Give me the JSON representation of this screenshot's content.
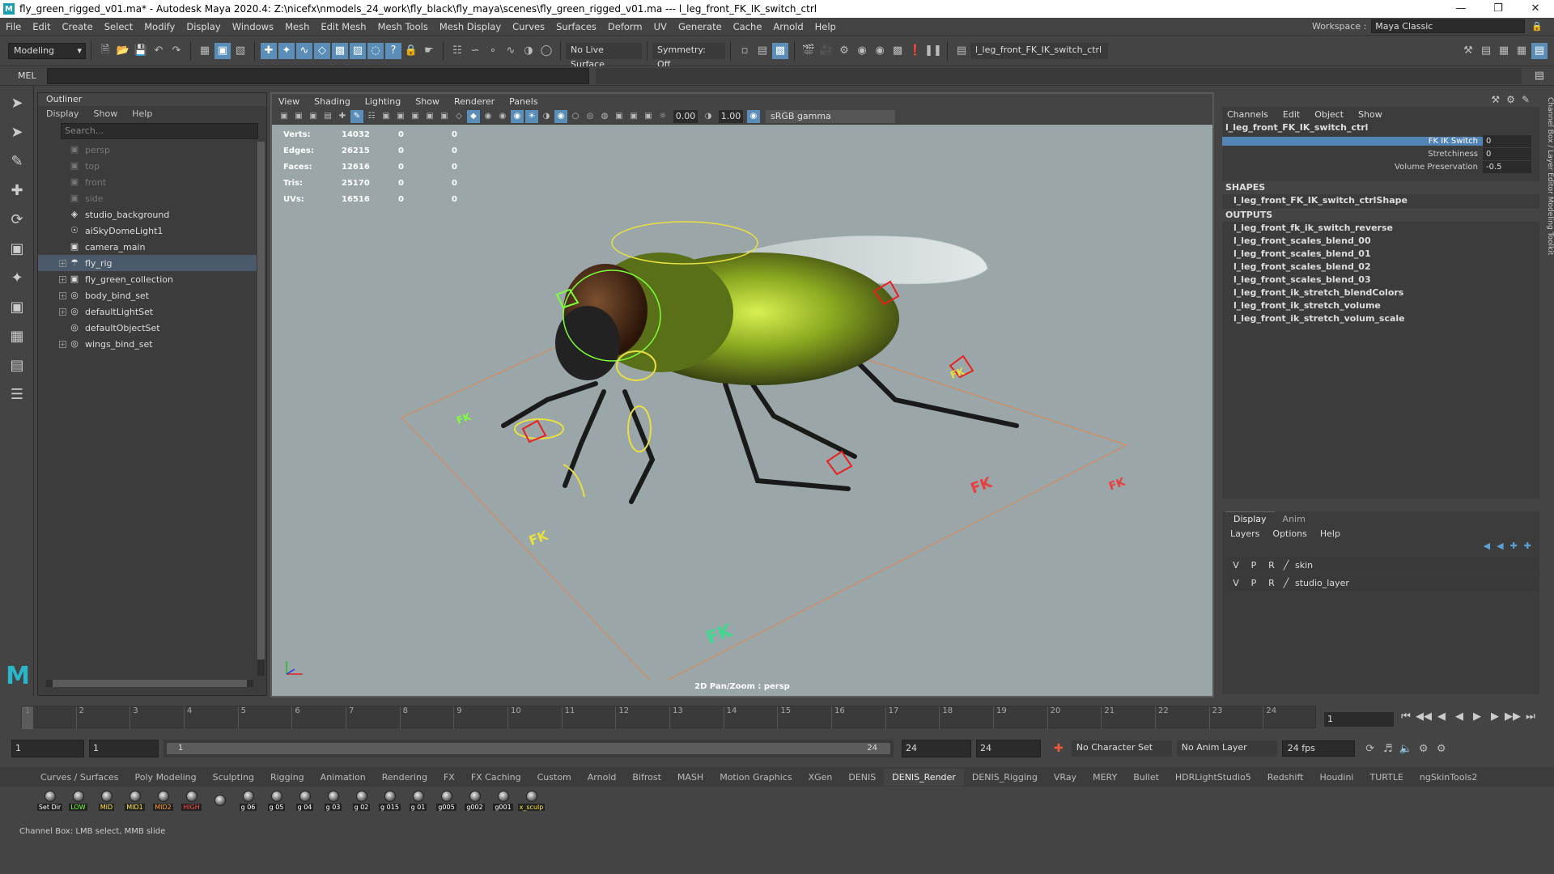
{
  "title": "fly_green_rigged_v01.ma* - Autodesk Maya 2020.4: Z:\\nicefx\\nmodels_24_work\\fly_black\\fly_maya\\scenes\\fly_green_rigged_v01.ma  ---  l_leg_front_FK_IK_switch_ctrl",
  "menu": [
    "File",
    "Edit",
    "Create",
    "Select",
    "Modify",
    "Display",
    "Windows",
    "Mesh",
    "Edit Mesh",
    "Mesh Tools",
    "Mesh Display",
    "Curves",
    "Surfaces",
    "Deform",
    "UV",
    "Generate",
    "Cache",
    "Arnold",
    "Help"
  ],
  "workspace_label": "Workspace :",
  "workspace_value": "Maya Classic",
  "mode": "Modeling",
  "live_surface": "No Live Surface",
  "symmetry": "Symmetry: Off",
  "selected_field": "l_leg_front_FK_IK_switch_ctrl",
  "mel_label": "MEL",
  "outliner": {
    "title": "Outliner",
    "menu": [
      "Display",
      "Show",
      "Help"
    ],
    "search_placeholder": "Search...",
    "items": [
      {
        "name": "persp",
        "dim": true,
        "icon": "camera-icon"
      },
      {
        "name": "top",
        "dim": true,
        "icon": "camera-icon"
      },
      {
        "name": "front",
        "dim": true,
        "icon": "camera-icon"
      },
      {
        "name": "side",
        "dim": true,
        "icon": "camera-icon"
      },
      {
        "name": "studio_background",
        "icon": "mesh-icon"
      },
      {
        "name": "aiSkyDomeLight1",
        "icon": "light-icon"
      },
      {
        "name": "camera_main",
        "icon": "camera-icon"
      },
      {
        "name": "fly_rig",
        "icon": "joint-icon",
        "exp": true,
        "sel": true
      },
      {
        "name": "fly_green_collection",
        "icon": "collection-icon",
        "exp": true
      },
      {
        "name": "body_bind_set",
        "icon": "set-icon",
        "exp": true
      },
      {
        "name": "defaultLightSet",
        "icon": "set-icon",
        "exp": true
      },
      {
        "name": "defaultObjectSet",
        "icon": "set-icon"
      },
      {
        "name": "wings_bind_set",
        "icon": "set-icon",
        "exp": true
      }
    ]
  },
  "viewport": {
    "menu": [
      "View",
      "Shading",
      "Lighting",
      "Show",
      "Renderer",
      "Panels"
    ],
    "exposure": "0.00",
    "gamma": "1.00",
    "colorspace": "sRGB gamma",
    "caption": "2D Pan/Zoom : persp",
    "hud": [
      {
        "k": "Verts:",
        "v": "14032",
        "a": "0",
        "b": "0"
      },
      {
        "k": "Edges:",
        "v": "26215",
        "a": "0",
        "b": "0"
      },
      {
        "k": "Faces:",
        "v": "12616",
        "a": "0",
        "b": "0"
      },
      {
        "k": "Tris:",
        "v": "25170",
        "a": "0",
        "b": "0"
      },
      {
        "k": "UVs:",
        "v": "16516",
        "a": "0",
        "b": "0"
      }
    ]
  },
  "channelbox": {
    "menu": [
      "Channels",
      "Edit",
      "Object",
      "Show"
    ],
    "object": "l_leg_front_FK_IK_switch_ctrl",
    "attrs": [
      {
        "name": "FK IK Switch",
        "value": "0"
      },
      {
        "name": "Stretchiness",
        "value": "0"
      },
      {
        "name": "Volume Preservation",
        "value": "-0.5"
      }
    ],
    "shapes_label": "SHAPES",
    "shape": "l_leg_front_FK_IK_switch_ctrlShape",
    "outputs_label": "OUTPUTS",
    "outputs": [
      "l_leg_front_fk_ik_switch_reverse",
      "l_leg_front_scales_blend_00",
      "l_leg_front_scales_blend_01",
      "l_leg_front_scales_blend_02",
      "l_leg_front_scales_blend_03",
      "l_leg_front_ik_stretch_blendColors",
      "l_leg_front_ik_stretch_volume",
      "l_leg_front_ik_stretch_volum_scale"
    ]
  },
  "layers": {
    "tabs": [
      "Display",
      "Anim"
    ],
    "menu": [
      "Layers",
      "Options",
      "Help"
    ],
    "items": [
      "skin",
      "studio_layer"
    ]
  },
  "sidetabs": "Channel Box / Layer Editor   Modeling Toolkit",
  "timeline": {
    "ticks": [
      "1",
      "2",
      "3",
      "4",
      "5",
      "6",
      "7",
      "8",
      "9",
      "10",
      "11",
      "12",
      "13",
      "14",
      "15",
      "16",
      "17",
      "18",
      "19",
      "20",
      "21",
      "22",
      "23",
      "24"
    ],
    "current": "1"
  },
  "range": {
    "start": "1",
    "start2": "1",
    "slider_start": "1",
    "slider_end": "24",
    "end": "24",
    "end2": "24",
    "character": "No Character Set",
    "anim_layer": "No Anim Layer",
    "fps": "24 fps"
  },
  "shelftabs": [
    "Curves / Surfaces",
    "Poly Modeling",
    "Sculpting",
    "Rigging",
    "Animation",
    "Rendering",
    "FX",
    "FX Caching",
    "Custom",
    "Arnold",
    "Bifrost",
    "MASH",
    "Motion Graphics",
    "XGen",
    "DENIS",
    "DENIS_Render",
    "DENIS_Rigging",
    "VRay",
    "MERY",
    "Bullet",
    "HDRLightStudio5",
    "Redshift",
    "Houdini",
    "TURTLE",
    "ngSkinTools2"
  ],
  "active_shelf": "DENIS_Render",
  "shelf_buttons": [
    {
      "label": "Set Dir",
      "color": "#ffffff"
    },
    {
      "label": "LOW",
      "color": "#7cff3a"
    },
    {
      "label": "MID",
      "color": "#ffe84a"
    },
    {
      "label": "MID1",
      "color": "#ffe84a"
    },
    {
      "label": "MID2",
      "color": "#ff9a3a"
    },
    {
      "label": "HIGH",
      "color": "#ff4a4a"
    },
    {
      "label": "",
      "color": "#ffffff"
    },
    {
      "label": "g 06",
      "color": "#ffffff"
    },
    {
      "label": "g 05",
      "color": "#ffffff"
    },
    {
      "label": "g 04",
      "color": "#ffffff"
    },
    {
      "label": "g 03",
      "color": "#ffffff"
    },
    {
      "label": "g 02",
      "color": "#ffffff"
    },
    {
      "label": "g 015",
      "color": "#ffffff"
    },
    {
      "label": "g 01",
      "color": "#ffffff"
    },
    {
      "label": "g005",
      "color": "#ffffff"
    },
    {
      "label": "g002",
      "color": "#ffffff"
    },
    {
      "label": "g001",
      "color": "#ffffff"
    },
    {
      "label": "x_sculp",
      "color": "#ffe84a"
    }
  ],
  "help": "Channel Box: LMB select, MMB slide"
}
